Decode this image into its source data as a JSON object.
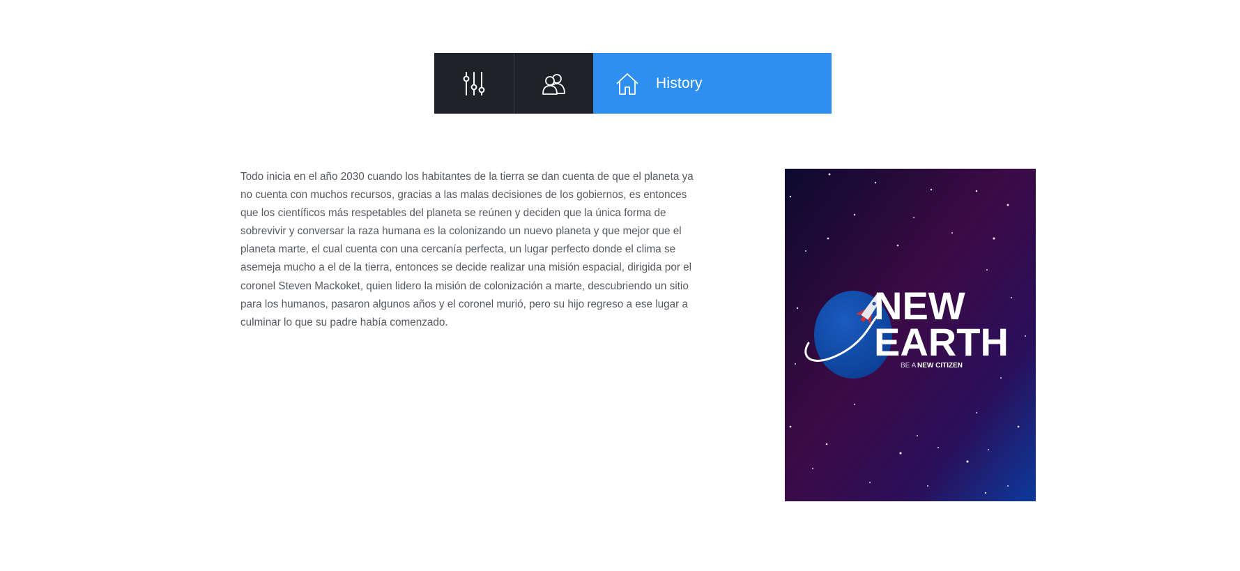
{
  "tabs": [
    {
      "icon": "sliders-icon",
      "label": ""
    },
    {
      "icon": "users-icon",
      "label": ""
    },
    {
      "icon": "home-icon",
      "label": "History",
      "active": true
    }
  ],
  "colors": {
    "tab_dark": "#1f2329",
    "tab_active": "#2f8fee",
    "text": "#555a60",
    "poster_bg_dark": "#0c0a2e",
    "poster_bg_purple": "#3c0a45",
    "poster_bg_blue": "#0b3a9c",
    "planet": "#0d4aa8",
    "rocket_accent": "#d9302f"
  },
  "content": {
    "paragraph": "Todo inicia en el año 2030 cuando los habitantes de la tierra se dan cuenta de que el planeta ya no cuenta con muchos recursos, gracias a las malas decisiones de los gobiernos, es entonces que los científicos más respetables del planeta se reúnen y deciden que la única forma de sobrevivir y conversar la raza humana es la colonizando un nuevo planeta y que mejor que el planeta marte, el cual cuenta con una cercanía perfecta, un lugar perfecto donde el clima se asemeja mucho a el de la tierra, entonces se decide realizar una misión espacial, dirigida por el coronel Steven Mackoket, quien lidero la misión de colonización a marte, descubriendo un sitio para los humanos, pasaron algunos años y el coronel murió, pero su hijo regreso a ese lugar a culminar lo que su padre había comenzado."
  },
  "poster": {
    "title_line1": "NEW",
    "title_line2": "EARTH",
    "tagline_prefix": "BE A",
    "tagline_bold": "NEW CITIZEN"
  }
}
